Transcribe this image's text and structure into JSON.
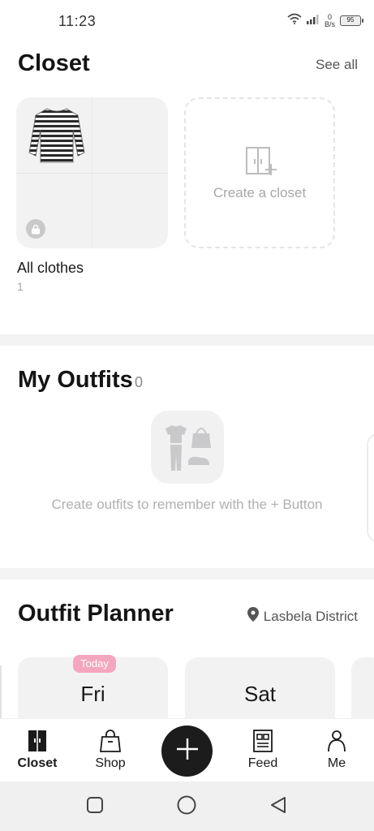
{
  "status_bar": {
    "time": "11:23",
    "net_speed_value": "0",
    "net_speed_unit": "B/s",
    "battery": "95"
  },
  "closet": {
    "title": "Closet",
    "see_all": "See all",
    "create_label": "Create a closet",
    "items": [
      {
        "name": "All clothes",
        "count": "1"
      }
    ]
  },
  "outfits": {
    "title": "My Outfits",
    "count": "0",
    "hint": "Create outfits to remember with the + Button"
  },
  "planner": {
    "title": "Outfit Planner",
    "location": "Lasbela District",
    "today_badge": "Today",
    "days": [
      "Fri",
      "Sat"
    ]
  },
  "nav": {
    "items": [
      {
        "label": "Closet",
        "icon": "wardrobe-icon"
      },
      {
        "label": "Shop",
        "icon": "shopping-bag-icon"
      },
      {
        "label": "Feed",
        "icon": "newspaper-icon"
      },
      {
        "label": "Me",
        "icon": "person-icon"
      }
    ],
    "fab_icon": "plus-icon"
  },
  "colors": {
    "accent_dark": "#1c1c1c",
    "today_badge": "#f4a6bf",
    "card_bg": "#f2f2f3"
  }
}
